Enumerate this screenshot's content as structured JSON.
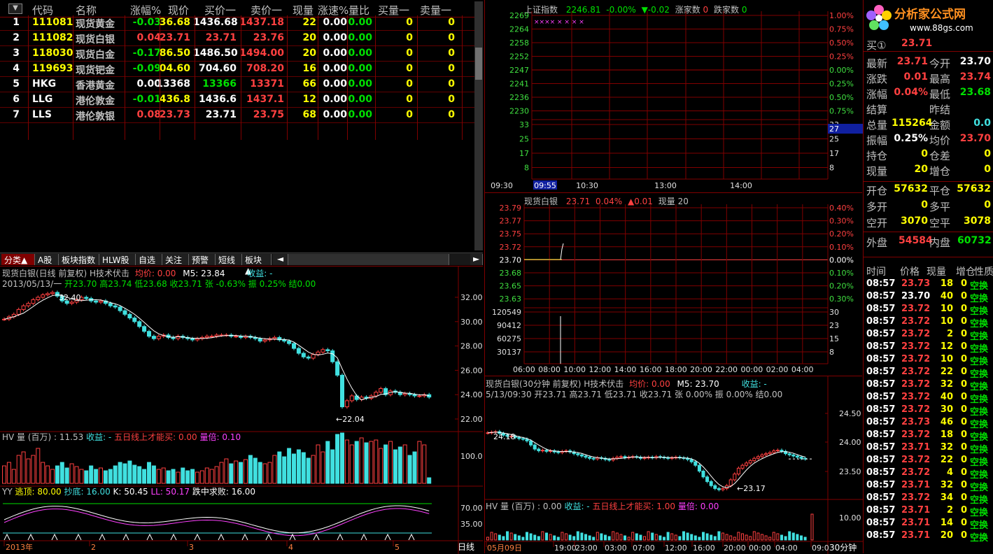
{
  "quote_table": {
    "headers": [
      "代码",
      "名称",
      "涨幅%",
      "现价",
      "买价一",
      "卖价一",
      "现量",
      "涨速%",
      "量比",
      "买量一",
      "卖量一"
    ],
    "rows": [
      {
        "idx": "1",
        "code": "111081",
        "name": "现货黄金",
        "chg": "-0.03",
        "price": "36.68",
        "bid": "1436.68",
        "ask": "1437.18",
        "vol": "22",
        "speed": "0.00",
        "ratio": "0.00",
        "bvol": "0",
        "avol": "0"
      },
      {
        "idx": "2",
        "code": "111082",
        "name": "现货白银",
        "chg": "0.04",
        "price": "23.71",
        "bid": "23.71",
        "ask": "23.76",
        "vol": "20",
        "speed": "0.00",
        "ratio": "0.00",
        "bvol": "0",
        "avol": "0"
      },
      {
        "idx": "3",
        "code": "118030",
        "name": "现货白金",
        "chg": "-0.17",
        "price": "86.50",
        "bid": "1486.50",
        "ask": "1494.00",
        "vol": "20",
        "speed": "0.00",
        "ratio": "0.00",
        "bvol": "0",
        "avol": "0"
      },
      {
        "idx": "4",
        "code": "119693",
        "name": "现货钯金",
        "chg": "-0.09",
        "price": "04.60",
        "bid": "704.60",
        "ask": "708.20",
        "vol": "16",
        "speed": "0.00",
        "ratio": "0.00",
        "bvol": "0",
        "avol": "0"
      },
      {
        "idx": "5",
        "code": "HKG",
        "name": "香港黄金",
        "chg": "0.00",
        "price": "13368",
        "bid": "13366",
        "ask": "13371",
        "vol": "66",
        "speed": "0.00",
        "ratio": "0.00",
        "bvol": "0",
        "avol": "0"
      },
      {
        "idx": "6",
        "code": "LLG",
        "name": "港伦敦金",
        "chg": "-0.01",
        "price": "436.8",
        "bid": "1436.6",
        "ask": "1437.1",
        "vol": "12",
        "speed": "0.00",
        "ratio": "0.00",
        "bvol": "0",
        "avol": "0"
      },
      {
        "idx": "7",
        "code": "LLS",
        "name": "港伦敦银",
        "chg": "0.08",
        "price": "23.73",
        "bid": "23.71",
        "ask": "23.75",
        "vol": "68",
        "speed": "0.00",
        "ratio": "0.00",
        "bvol": "0",
        "avol": "0"
      }
    ]
  },
  "tabs": [
    "分类▲",
    "A股",
    "板块指数",
    "HLW股",
    "自选",
    "关注",
    "预警",
    "短线",
    "板块▲"
  ],
  "daily_chart": {
    "title": "现货白银(日线 前复权) H技术伏击",
    "avg_label": "均价: 0.00",
    "ma_label": "M5: 23.84",
    "profit_label": "收益: -",
    "info_line_date": "2013/05/13/一",
    "info_line": "开23.70 高23.74 低23.68 收23.71 张 -0.63% 振 0.25% 结0.00",
    "yaxis": [
      "32.00",
      "30.00",
      "28.00",
      "26.00",
      "24.00",
      "22.00"
    ],
    "high_mark": "32.40",
    "low_mark": "←22.04",
    "vol_title": "HV 量 (百万) : 11.53",
    "vol_profit": "收益: -",
    "vol_rule": "五日线上才能买: 0.00",
    "vol_mult": "量倍: 0.10",
    "vol_axis": "100.00",
    "osc_title": "YY",
    "osc_escape": "逃顶: 80.00",
    "osc_bottom": "抄底: 16.00",
    "osc_k": "K: 50.45",
    "osc_ll": "LL: 50.17",
    "osc_fail": "跌中求败: 16.00",
    "osc_axis": [
      "70.00",
      "35.00"
    ],
    "xaxis": [
      "2013年",
      "2",
      "3",
      "4",
      "5"
    ],
    "period": "日线"
  },
  "index_chart": {
    "title": "上证指数",
    "value": "2246.81",
    "pct": "-0.00%",
    "chg": "▼-0.02",
    "up_label": "涨家数",
    "up_count": "0",
    "down_label": "跌家数",
    "down_count": "0",
    "yaxis_left": [
      "2269",
      "2264",
      "2258",
      "2252",
      "2247",
      "2241",
      "2236",
      "2230"
    ],
    "yaxis_right": [
      "1.00%",
      "0.75%",
      "0.50%",
      "0.25%",
      "0.00%",
      "0.25%",
      "0.50%",
      "0.75%"
    ],
    "vol_left": [
      "33",
      "25",
      "17",
      "8"
    ],
    "vol_right": [
      "33",
      "25",
      "17",
      "8"
    ],
    "cursor_value": "27",
    "xaxis": [
      "09:30",
      "09:55",
      "10:30",
      "13:00",
      "14:00"
    ]
  },
  "silver_intraday": {
    "title": "现货白银",
    "price": "23.71",
    "pct": "0.04%",
    "chg": "▲0.01",
    "vol_label": "现量 20",
    "yaxis_left": [
      "23.79",
      "23.77",
      "23.75",
      "23.72",
      "23.70",
      "23.68",
      "23.65",
      "23.63"
    ],
    "yaxis_right": [
      "0.40%",
      "0.30%",
      "0.20%",
      "0.10%",
      "0.00%",
      "0.10%",
      "0.20%",
      "0.30%"
    ],
    "vol_left": [
      "120549",
      "90412",
      "60275",
      "30137"
    ],
    "vol_right": [
      "30",
      "23",
      "15",
      "8"
    ],
    "xaxis": [
      "06:00",
      "08:00",
      "10:00",
      "12:00",
      "14:00",
      "16:00",
      "18:00",
      "20:00",
      "22:00",
      "00:00",
      "02:00",
      "04:00"
    ]
  },
  "thirty_min_chart": {
    "title": "现货白银(30分钟 前复权) H技术伏击",
    "avg_label": "均价: 0.00",
    "ma_label": "M5: 23.70",
    "profit_label": "收益: -",
    "info_line": "5/13/09:30 开23.71 高23.71 低23.71 收23.71 张 0.00% 振 0.00% 结0.00",
    "yaxis": [
      "24.50",
      "24.00",
      "23.50"
    ],
    "high_mark": "24.18",
    "low_mark": "←23.17",
    "vol_title": "HV 量 (百万) : 0.00",
    "vol_profit": "收益: -",
    "vol_rule": "五日线上才能买: 1.00",
    "vol_mult": "量倍: 0.00",
    "vol_axis": "10.00",
    "xaxis": [
      "05月09日",
      "19:00",
      "23:00",
      "03:00",
      "07:00",
      "12:00",
      "16:00",
      "20:00",
      "00:00",
      "04:00",
      "09:0"
    ],
    "period": "30分钟"
  },
  "logo": {
    "text": "分析家公式网",
    "url": "www.88gs.com"
  },
  "right_panel": {
    "buy1_label": "买①",
    "buy1_value": "23.71",
    "stats": [
      {
        "l1": "最新",
        "v1": "23.71",
        "c1": "red",
        "l2": "今开",
        "v2": "23.70",
        "c2": "wht"
      },
      {
        "l1": "涨跌",
        "v1": "0.01",
        "c1": "red",
        "l2": "最高",
        "v2": "23.74",
        "c2": "red"
      },
      {
        "l1": "涨幅",
        "v1": "0.04%",
        "c1": "red",
        "l2": "最低",
        "v2": "23.68",
        "c2": "grn"
      },
      {
        "l1": "结算",
        "v1": "",
        "c1": "wht",
        "l2": "昨结",
        "v2": "",
        "c2": "wht"
      },
      {
        "l1": "总量",
        "v1": "115264",
        "c1": "yel",
        "l2": "金额",
        "v2": "0.0",
        "c2": "cyan"
      },
      {
        "l1": "振幅",
        "v1": "0.25%",
        "c1": "wht",
        "l2": "均价",
        "v2": "23.70",
        "c2": "red"
      },
      {
        "l1": "持仓",
        "v1": "0",
        "c1": "yel",
        "l2": "仓差",
        "v2": "0",
        "c2": "yel"
      },
      {
        "l1": "现量",
        "v1": "20",
        "c1": "yel",
        "l2": "增仓",
        "v2": "0",
        "c2": "yel"
      }
    ],
    "stats2": [
      {
        "l1": "开仓",
        "v1": "57632",
        "c1": "yel",
        "l2": "平仓",
        "v2": "57632",
        "c2": "yel"
      },
      {
        "l1": "多开",
        "v1": "0",
        "c1": "yel",
        "l2": "多平",
        "v2": "0",
        "c2": "yel"
      },
      {
        "l1": "空开",
        "v1": "3070",
        "c1": "yel",
        "l2": "空平",
        "v2": "3078",
        "c2": "yel"
      }
    ],
    "outer_label": "外盘",
    "outer_value": "54584",
    "inner_label": "内盘",
    "inner_value": "60732",
    "trade_headers": [
      "时间",
      "价格",
      "现量",
      "增仓",
      "性质"
    ],
    "trades": [
      {
        "t": "08:57",
        "p": "23.73",
        "pc": "red",
        "v": "18",
        "o": "0",
        "n": "空换"
      },
      {
        "t": "08:57",
        "p": "23.70",
        "pc": "wht",
        "v": "40",
        "o": "0",
        "n": "空换"
      },
      {
        "t": "08:57",
        "p": "23.72",
        "pc": "red",
        "v": "10",
        "o": "0",
        "n": "空换"
      },
      {
        "t": "08:57",
        "p": "23.72",
        "pc": "red",
        "v": "10",
        "o": "0",
        "n": "空换"
      },
      {
        "t": "08:57",
        "p": "23.72",
        "pc": "red",
        "v": "2",
        "o": "0",
        "n": "空换"
      },
      {
        "t": "08:57",
        "p": "23.72",
        "pc": "red",
        "v": "12",
        "o": "0",
        "n": "空换"
      },
      {
        "t": "08:57",
        "p": "23.72",
        "pc": "red",
        "v": "10",
        "o": "0",
        "n": "空换"
      },
      {
        "t": "08:57",
        "p": "23.72",
        "pc": "red",
        "v": "22",
        "o": "0",
        "n": "空换"
      },
      {
        "t": "08:57",
        "p": "23.72",
        "pc": "red",
        "v": "32",
        "o": "0",
        "n": "空换"
      },
      {
        "t": "08:57",
        "p": "23.72",
        "pc": "red",
        "v": "40",
        "o": "0",
        "n": "空换"
      },
      {
        "t": "08:57",
        "p": "23.72",
        "pc": "red",
        "v": "30",
        "o": "0",
        "n": "空换"
      },
      {
        "t": "08:57",
        "p": "23.73",
        "pc": "red",
        "v": "46",
        "o": "0",
        "n": "空换"
      },
      {
        "t": "08:57",
        "p": "23.72",
        "pc": "red",
        "v": "18",
        "o": "0",
        "n": "空换"
      },
      {
        "t": "08:57",
        "p": "23.71",
        "pc": "red",
        "v": "32",
        "o": "0",
        "n": "空换"
      },
      {
        "t": "08:57",
        "p": "23.72",
        "pc": "red",
        "v": "22",
        "o": "0",
        "n": "空换"
      },
      {
        "t": "08:57",
        "p": "23.72",
        "pc": "red",
        "v": "4",
        "o": "0",
        "n": "空换"
      },
      {
        "t": "08:57",
        "p": "23.71",
        "pc": "red",
        "v": "32",
        "o": "0",
        "n": "空换"
      },
      {
        "t": "08:57",
        "p": "23.72",
        "pc": "red",
        "v": "34",
        "o": "0",
        "n": "空换"
      },
      {
        "t": "08:57",
        "p": "23.71",
        "pc": "red",
        "v": "2",
        "o": "0",
        "n": "空换"
      },
      {
        "t": "08:57",
        "p": "23.71",
        "pc": "red",
        "v": "14",
        "o": "0",
        "n": "空换"
      },
      {
        "t": "08:57",
        "p": "23.71",
        "pc": "red",
        "v": "20",
        "o": "0",
        "n": "空换"
      }
    ]
  },
  "colors": {
    "up": "#ff4040",
    "down": "#00e000",
    "grid": "#800000",
    "volume_up": "#ff4040",
    "volume_down": "#40e0e0"
  }
}
